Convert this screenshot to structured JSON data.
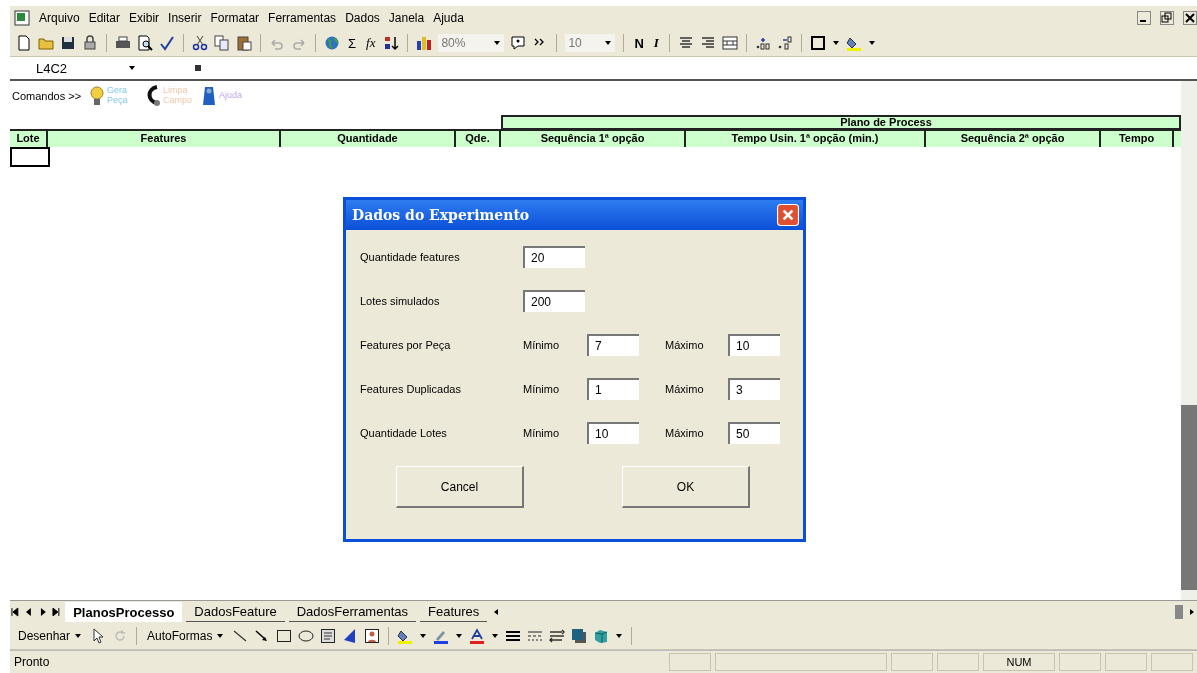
{
  "menu": [
    "Arquivo",
    "Editar",
    "Exibir",
    "Inserir",
    "Formatar",
    "Ferramentas",
    "Dados",
    "Janela",
    "Ajuda"
  ],
  "toolbar": {
    "sum_label": "Σ",
    "function_label": "fx",
    "zoom": "80%",
    "font_size": "10",
    "bold_label": "N",
    "italic_label": "I"
  },
  "name_box": {
    "value": "L4C2"
  },
  "commands": {
    "label": "Comandos >>",
    "buttons": [
      "Gera Peça",
      "Limpa Campo",
      "Ajuda"
    ]
  },
  "sheet": {
    "group_header": "Plano de Process",
    "columns": [
      "Lote",
      "Features",
      "Quantidade",
      "Qde.",
      "Sequência 1ª opção",
      "Tempo Usin. 1ª opção (min.)",
      "Sequência 2ª opção",
      "Tempo"
    ]
  },
  "dialog": {
    "title": "Dados do Experimento",
    "rows": [
      {
        "label": "Quantidade features",
        "fields": [
          {
            "value": "20"
          }
        ]
      },
      {
        "label": "Lotes simulados",
        "fields": [
          {
            "value": "200"
          }
        ]
      },
      {
        "label": "Features por Peça",
        "fields": [
          {
            "label": "Mínimo",
            "value": "7"
          },
          {
            "label": "Máximo",
            "value": "10"
          }
        ]
      },
      {
        "label": "Features Duplicadas",
        "fields": [
          {
            "label": "Mínimo",
            "value": "1"
          },
          {
            "label": "Máximo",
            "value": "3"
          }
        ]
      },
      {
        "label": "Quantidade Lotes",
        "fields": [
          {
            "label": "Mínimo",
            "value": "10"
          },
          {
            "label": "Máximo",
            "value": "50"
          }
        ]
      }
    ],
    "buttons": [
      "Cancel",
      "OK"
    ]
  },
  "sheet_tabs": [
    {
      "label": "PlanosProcesso",
      "selected": true
    },
    {
      "label": "DadosFeature",
      "selected": false
    },
    {
      "label": "DadosFerramentas",
      "selected": false
    },
    {
      "label": "Features",
      "selected": false
    }
  ],
  "drawing_toolbar": {
    "draw_menu": "Desenhar",
    "autoshapes_menu": "AutoFormas"
  },
  "status_bar": {
    "text": "Pronto",
    "indicators": [
      "NUM"
    ]
  }
}
